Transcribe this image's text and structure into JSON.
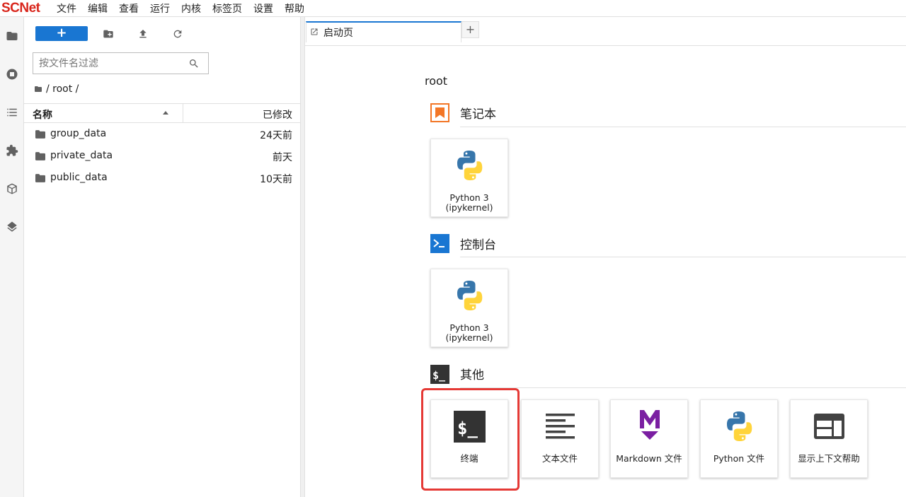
{
  "app": {
    "logo": "SCNet"
  },
  "menu": [
    "文件",
    "编辑",
    "查看",
    "运行",
    "内核",
    "标签页",
    "设置",
    "帮助"
  ],
  "activity_bar": [
    "folder-icon",
    "running-icon",
    "toc-icon",
    "extension-icon",
    "package-icon",
    "layers-icon"
  ],
  "filebrowser": {
    "new_label": "+",
    "filter_placeholder": "按文件名过滤",
    "breadcrumb": "/ root /",
    "header": {
      "name": "名称",
      "modified": "已修改"
    },
    "files": [
      {
        "name": "group_data",
        "modified": "24天前"
      },
      {
        "name": "private_data",
        "modified": "前天"
      },
      {
        "name": "public_data",
        "modified": "10天前"
      }
    ]
  },
  "tabs": {
    "launcher_label": "启动页",
    "add_label": "+"
  },
  "launcher": {
    "cwd": "root",
    "sections": {
      "notebook": {
        "title": "笔记本",
        "cards": [
          {
            "label": "Python 3\n(ipykernel)"
          }
        ]
      },
      "console": {
        "title": "控制台",
        "cards": [
          {
            "label": "Python 3\n(ipykernel)"
          }
        ]
      },
      "other": {
        "title": "其他",
        "cards": [
          {
            "label": "终端"
          },
          {
            "label": "文本文件"
          },
          {
            "label": "Markdown 文件"
          },
          {
            "label": "Python 文件"
          },
          {
            "label": "显示上下文帮助"
          }
        ]
      }
    }
  },
  "colors": {
    "accent": "#1976d2",
    "highlight": "#e53935",
    "logo": "#d9261c",
    "notebook": "#f37626"
  }
}
